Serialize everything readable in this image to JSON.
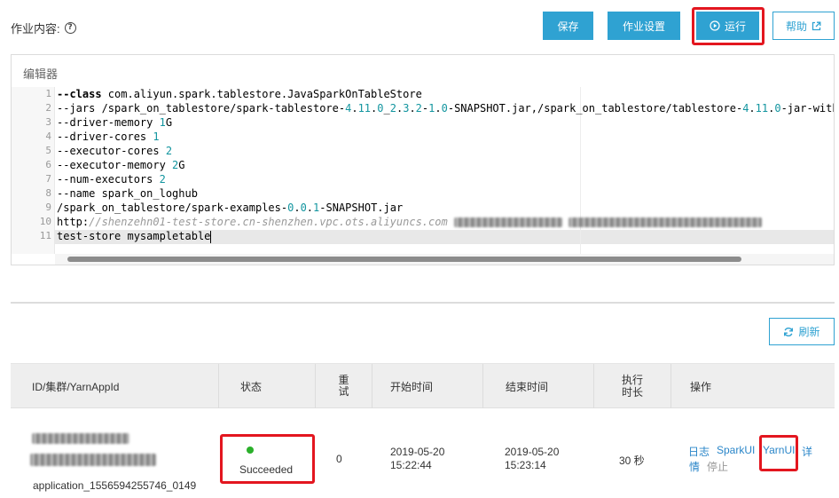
{
  "header": {
    "job_content_label": "作业内容:",
    "help_symbol": "?",
    "buttons": {
      "save": "保存",
      "settings": "作业设置",
      "run": "运行",
      "help": "帮助"
    }
  },
  "editor": {
    "title": "编辑器",
    "active_line": 11,
    "line_numbers": [
      "1",
      "2",
      "3",
      "4",
      "5",
      "6",
      "7",
      "8",
      "9",
      "10",
      "11"
    ],
    "lines": [
      "--class com.aliyun.spark.tablestore.JavaSparkOnTableStore",
      "--jars /spark_on_tablestore/spark-tablestore-4.11.0_2.3.2-1.0-SNAPSHOT.jar,/spark_on_tablestore/tablestore-4.11.0-jar-with",
      "--driver-memory 1G",
      "--driver-cores 1",
      "--executor-cores 2",
      "--executor-memory 2G",
      "--num-executors 2",
      "--name spark_on_loghub",
      "/spark_on_tablestore/spark-examples-0.0.1-SNAPSHOT.jar",
      "http://shenzehn01-test-store.cn-shenzhen.vpc.ots.aliyuncs.com",
      "test-store mysampletable"
    ]
  },
  "refresh_label": "刷新",
  "table": {
    "headers": {
      "id": "ID/集群/YarnAppId",
      "status": "状态",
      "retry": "重试",
      "start": "开始时间",
      "end": "结束时间",
      "duration": "执行时长",
      "actions": "操作"
    },
    "rows": [
      {
        "app_id": "application_1556594255746_0149",
        "status": "Succeeded",
        "retry": "0",
        "start_date": "2019-05-20",
        "start_time": "15:22:44",
        "end_date": "2019-05-20",
        "end_time": "15:23:14",
        "duration": "30 秒",
        "actions": {
          "log": "日志",
          "sparkui": "SparkUI",
          "yarnui": "YarnUI",
          "detail": "详情",
          "stop": "停止"
        }
      }
    ]
  },
  "colors": {
    "primary": "#2fa2d2",
    "highlight": "#e3161f",
    "link": "#2a86c9",
    "success": "#2bb02b",
    "number": "#12959f"
  }
}
